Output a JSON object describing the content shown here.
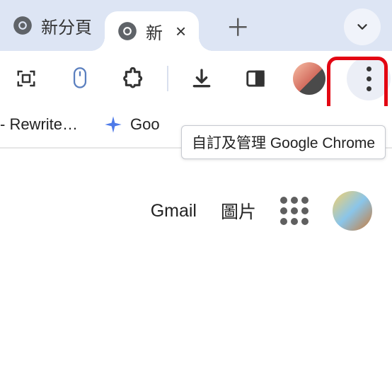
{
  "tabs": {
    "inactive_title": "新分頁",
    "active_title": "新",
    "close_label": "×",
    "new_tab_label": "＋",
    "dropdown_label": "▾"
  },
  "tooltip_text": "自訂及管理 Google Chrome",
  "bookmarks": {
    "item0": "- Rewrite…",
    "item1": "Goo"
  },
  "ntp": {
    "gmail": "Gmail",
    "images": "圖片"
  }
}
